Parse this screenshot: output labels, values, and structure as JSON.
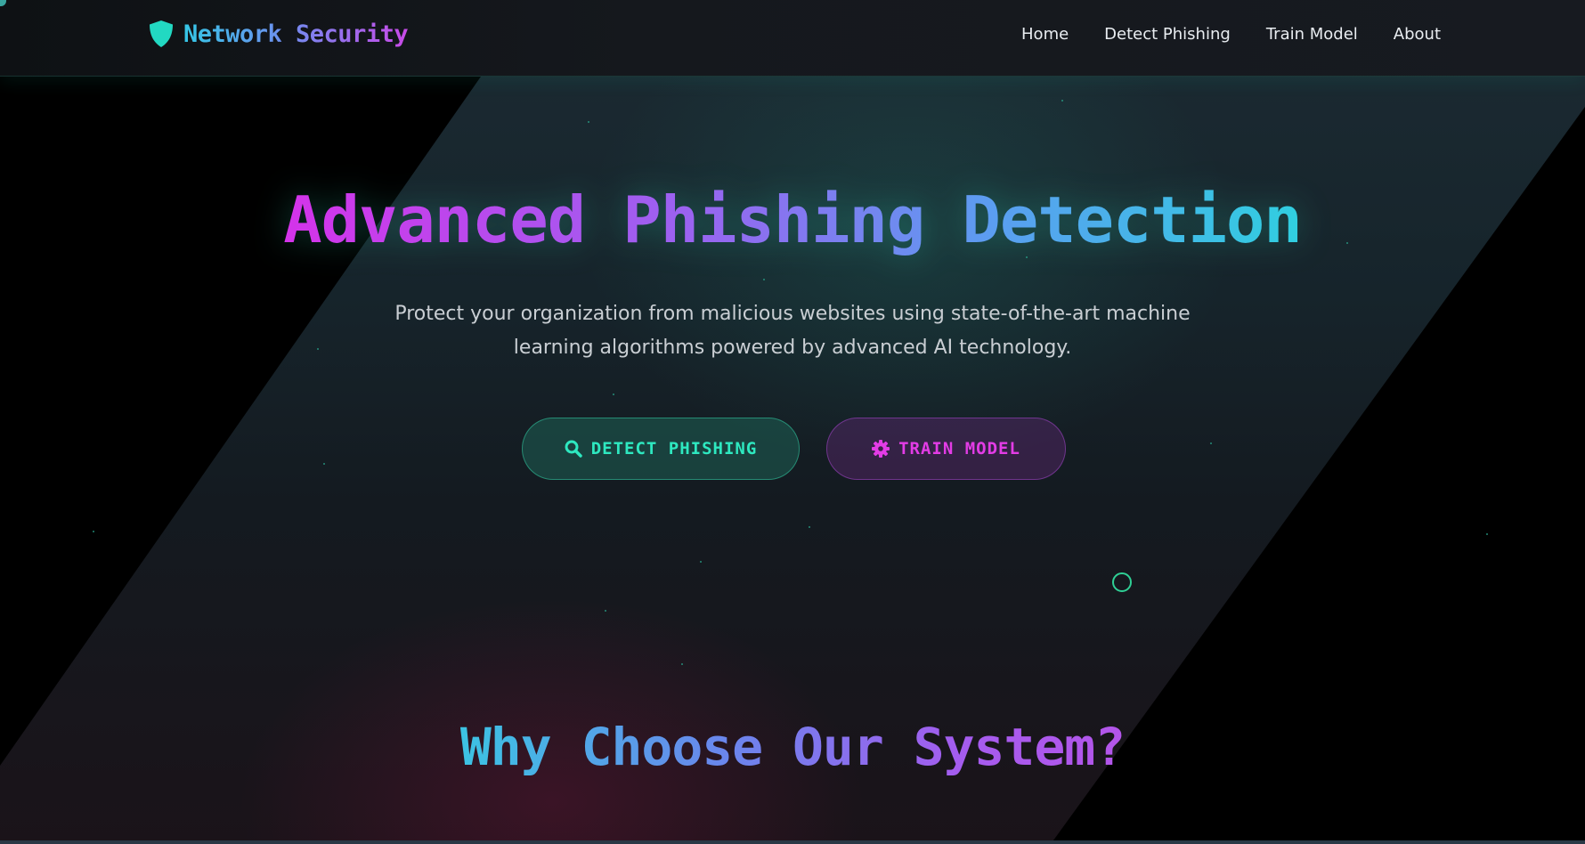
{
  "header": {
    "brand": "Network Security",
    "brand_icon": "shield-icon",
    "nav": [
      {
        "label": "Home"
      },
      {
        "label": "Detect Phishing"
      },
      {
        "label": "Train Model"
      },
      {
        "label": "About"
      }
    ]
  },
  "hero": {
    "title": "Advanced Phishing Detection",
    "subtitle": "Protect your organization from malicious websites using state-of-the-art machine learning algorithms powered by advanced AI technology.",
    "buttons": {
      "detect": {
        "label": "DETECT PHISHING",
        "icon": "search-icon"
      },
      "train": {
        "label": "TRAIN MODEL",
        "icon": "gear-icon"
      }
    }
  },
  "section": {
    "why_title": "Why Choose Our System?"
  },
  "colors": {
    "accent_teal": "#2ee8c0",
    "accent_magenta": "#e33ce6",
    "gradient_start": "#d433ea",
    "gradient_end": "#30cfe0"
  }
}
